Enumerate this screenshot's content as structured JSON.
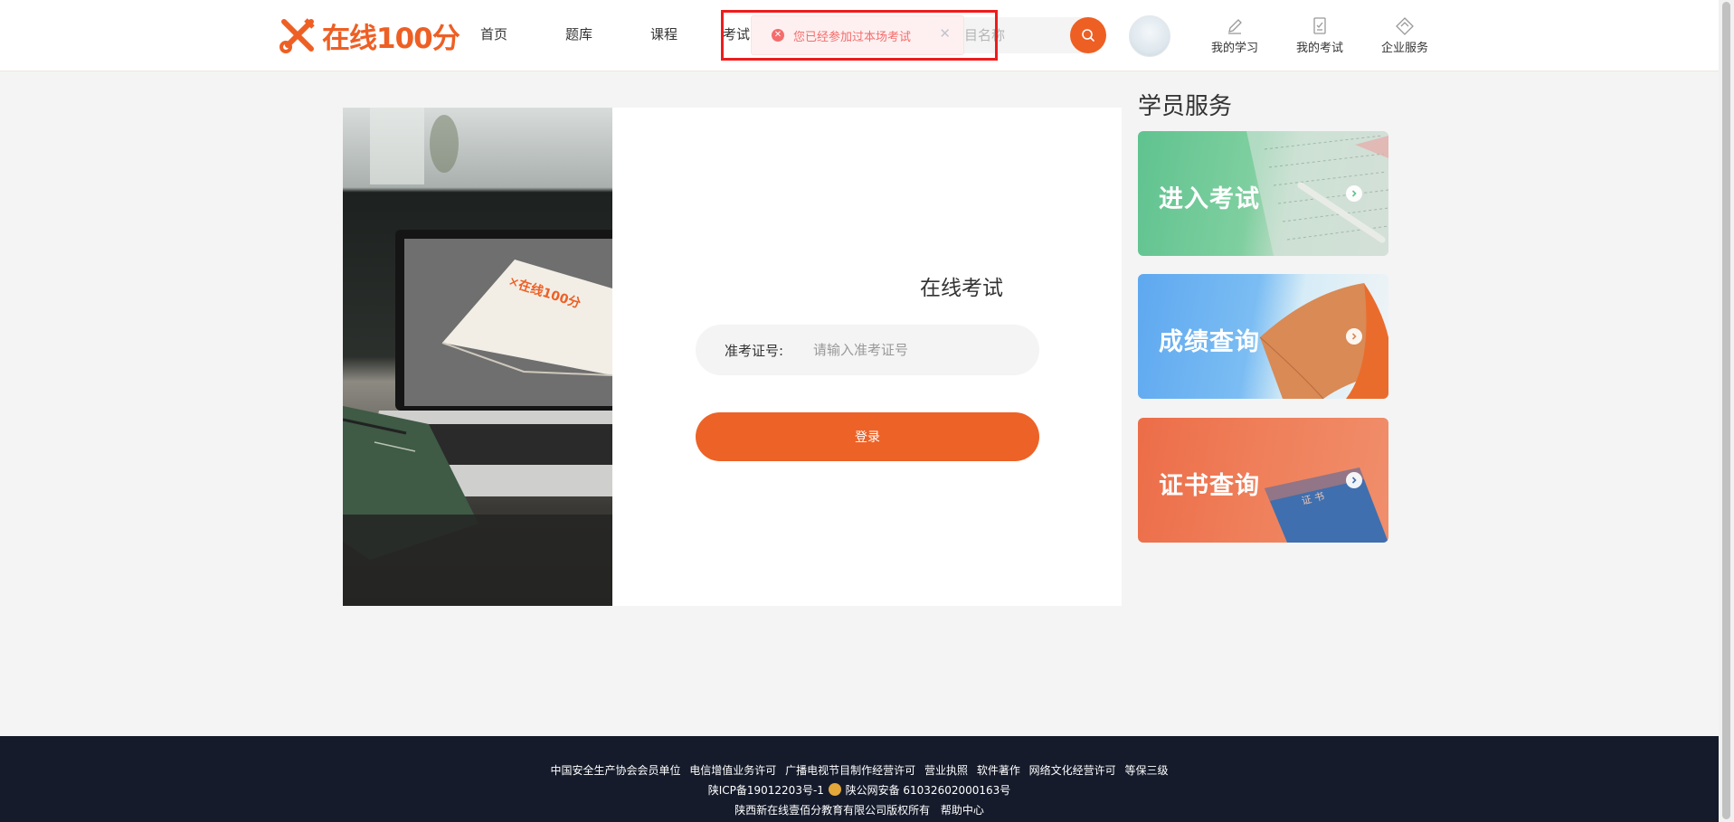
{
  "header": {
    "logo_text": "在线100分",
    "nav": [
      {
        "label": "首页"
      },
      {
        "label": "题库"
      },
      {
        "label": "课程"
      },
      {
        "label": "考试"
      }
    ],
    "search": {
      "placeholder": "的科目名称"
    },
    "user_menu": [
      {
        "label": "我的学习",
        "icon": "pencil-icon"
      },
      {
        "label": "我的考试",
        "icon": "exam-sheet-icon"
      },
      {
        "label": "企业服务",
        "icon": "diamond-icon"
      }
    ]
  },
  "toast": {
    "message": "您已经参加过本场考试",
    "type": "error",
    "color": "#f56c6c"
  },
  "login": {
    "title": "在线考试",
    "field_label": "准考证号:",
    "field_placeholder": "请输入准考证号",
    "field_value": "",
    "button_label": "登录"
  },
  "services": {
    "heading": "学员服务",
    "items": [
      {
        "label": "进入考试",
        "color": "#5fc38f"
      },
      {
        "label": "成绩查询",
        "color": "#5ea8f0"
      },
      {
        "label": "证书查询",
        "color": "#ec6d48"
      }
    ]
  },
  "footer": {
    "links": [
      "中国安全生产协会会员单位",
      "电信增值业务许可",
      "广播电视节目制作经营许可",
      "营业执照",
      "软件著作",
      "网络文化经营许可",
      "等保三级"
    ],
    "icp": "陕ICP备19012203号-1",
    "police": "陕公网安备 61032602000163号",
    "copyright": "陕西新在线壹佰分教育有限公司版权所有",
    "help": "帮助中心"
  },
  "colors": {
    "brand": "#ee5f24",
    "footer_bg": "#151b2b"
  }
}
